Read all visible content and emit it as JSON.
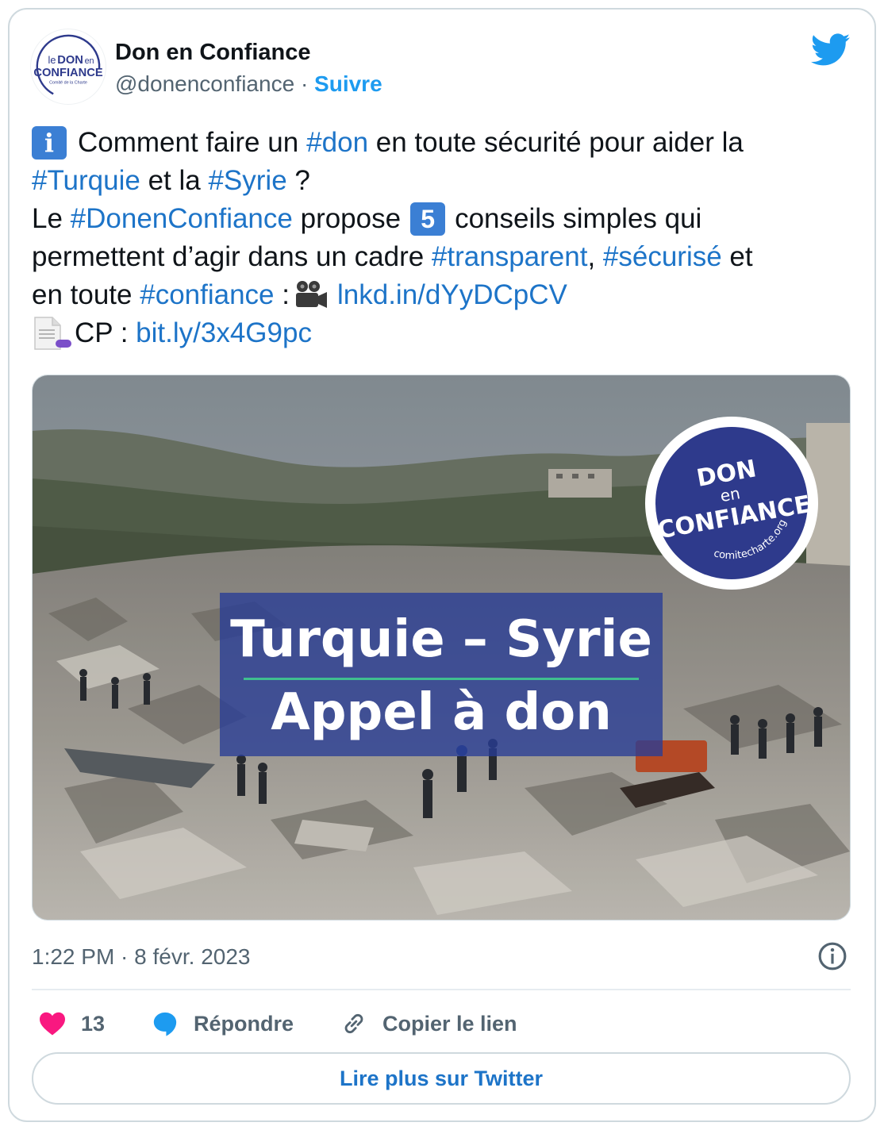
{
  "author": {
    "name": "Don en Confiance",
    "handle": "@donenconfiance",
    "separator": "·",
    "follow_label": "Suivre",
    "avatar_logo": {
      "line1_a": "le",
      "line1_b": "DON",
      "line1_c": "en",
      "line2": "CONFIANCE",
      "line3": "Comité de la Charte"
    }
  },
  "tweet": {
    "line1": {
      "pre": " Comment faire un ",
      "tag1": "#don",
      "post": " en toute sécurité pour aider la"
    },
    "line2": {
      "tag1": "#Turquie",
      "mid": " et la ",
      "tag2": "#Syrie",
      "post": " ?"
    },
    "line3": {
      "pre": "Le ",
      "tag1": "#DonenConfiance",
      "mid": " propose",
      "num": "5",
      "post": "conseils simples qui"
    },
    "line4": {
      "pre": "permettent d’agir dans un cadre ",
      "tag1": "#transparent",
      "mid": ", ",
      "tag2": "#sécurisé",
      "post": " et"
    },
    "line5": {
      "pre": "en toute ",
      "tag1": "#confiance",
      "mid": " :",
      "link": "lnkd.in/dYyDCpCV"
    },
    "line6": {
      "pre": "CP : ",
      "link": "bit.ly/3x4G9pc"
    },
    "info_emoji": "i"
  },
  "media": {
    "banner_line1": "Turquie – Syrie",
    "banner_line2": "Appel à don",
    "seal": {
      "line1": "DON",
      "line2": "en",
      "line3": "CONFIANCE",
      "line4": "comitecharte.org"
    },
    "colors": {
      "banner": "#283c96",
      "seal": "#2e3a8c",
      "rule": "#3fbf8f"
    }
  },
  "meta": {
    "timestamp": "1:22 PM · 8 févr. 2023"
  },
  "actions": {
    "likes": "13",
    "reply_label": "Répondre",
    "copy_label": "Copier le lien"
  },
  "read_more_label": "Lire plus sur Twitter",
  "colors": {
    "accent": "#1d9bf0",
    "link": "#1d74c8",
    "like": "#f91880",
    "muted": "#536471"
  }
}
